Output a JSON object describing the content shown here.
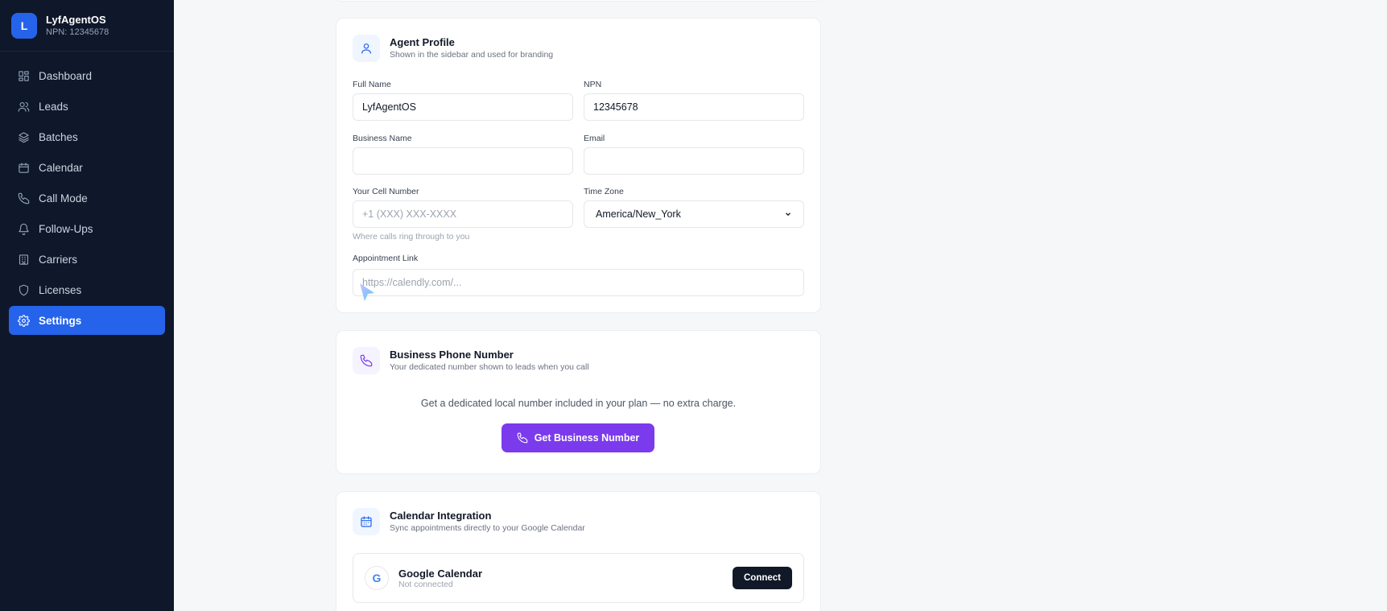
{
  "brand": {
    "initial": "L",
    "name": "LyfAgentOS",
    "npn": "NPN: 12345678"
  },
  "sidebar": {
    "items": [
      {
        "label": "Dashboard",
        "icon": "grid-icon"
      },
      {
        "label": "Leads",
        "icon": "users-icon"
      },
      {
        "label": "Batches",
        "icon": "layers-icon"
      },
      {
        "label": "Calendar",
        "icon": "calendar-icon"
      },
      {
        "label": "Call Mode",
        "icon": "phone-icon"
      },
      {
        "label": "Follow-Ups",
        "icon": "bell-icon"
      },
      {
        "label": "Carriers",
        "icon": "building-icon"
      },
      {
        "label": "Licenses",
        "icon": "shield-icon"
      },
      {
        "label": "Settings",
        "icon": "gear-icon",
        "active": true
      }
    ]
  },
  "agent_profile": {
    "title": "Agent Profile",
    "subtitle": "Shown in the sidebar and used for branding",
    "full_name_label": "Full Name",
    "full_name_value": "LyfAgentOS",
    "npn_label": "NPN",
    "npn_value": "12345678",
    "business_name_label": "Business Name",
    "business_name_value": "",
    "email_label": "Email",
    "email_value": "",
    "cell_label": "Your Cell Number",
    "cell_placeholder": "+1 (XXX) XXX-XXXX",
    "cell_hint": "Where calls ring through to you",
    "timezone_label": "Time Zone",
    "timezone_value": "America/New_York",
    "appointment_label": "Appointment Link",
    "appointment_placeholder": "https://calendly.com/..."
  },
  "business_phone": {
    "title": "Business Phone Number",
    "subtitle": "Your dedicated number shown to leads when you call",
    "description": "Get a dedicated local number included in your plan — no extra charge.",
    "button_label": "Get Business Number"
  },
  "calendar_integration": {
    "title": "Calendar Integration",
    "subtitle": "Sync appointments directly to your Google Calendar",
    "google_initial": "G",
    "provider_name": "Google Calendar",
    "status": "Not connected",
    "connect_label": "Connect"
  },
  "colors": {
    "sidebar_bg": "#0f172a",
    "accent": "#2563eb",
    "purple": "#7c3aed"
  }
}
